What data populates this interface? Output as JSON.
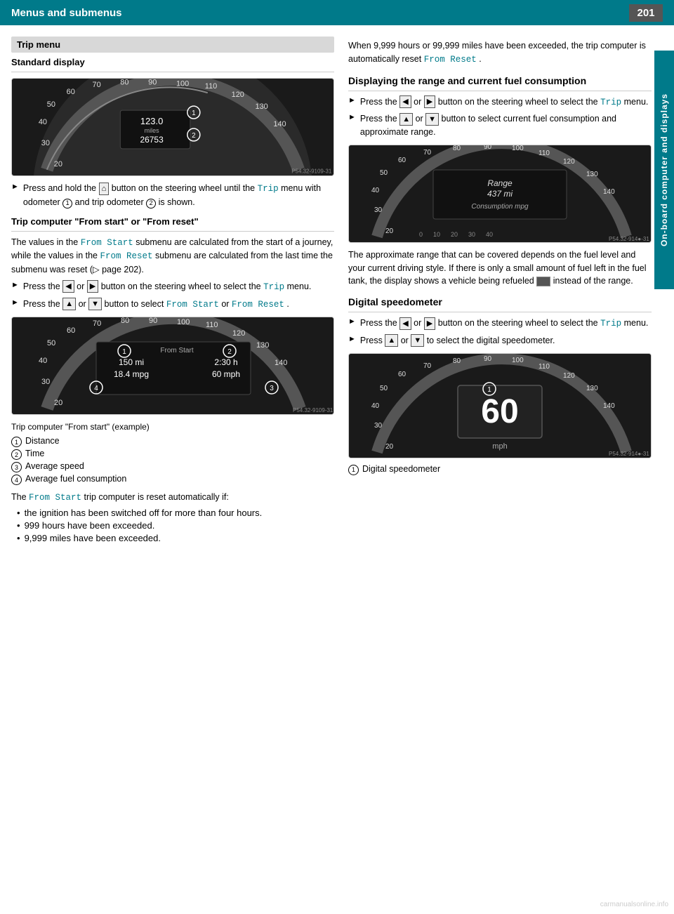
{
  "header": {
    "title": "Menus and submenus",
    "page": "201"
  },
  "sidebar": {
    "label": "On-board computer and displays"
  },
  "left": {
    "trip_menu_label": "Trip menu",
    "standard_display_title": "Standard display",
    "press_hold_instruction": "Press and hold the",
    "press_hold_instruction2": "button on the steering wheel until the",
    "trip_code": "Trip",
    "press_hold_instruction3": "menu with odometer",
    "odometer_num": "1",
    "press_hold_instruction4": "and trip odometer",
    "trip_odo_num": "2",
    "press_hold_instruction5": "is shown.",
    "trip_computer_title": "Trip computer \"From start\" or \"From reset\"",
    "body1": "The values in the",
    "from_start_code": "From Start",
    "body2": "submenu are calculated from the start of a journey, while the values in the",
    "from_reset_code": "From Reset",
    "body3": "submenu are calculated from the last time the submenu was reset (▷ page 202).",
    "press1": "Press the",
    "or1": "or",
    "btn_steer1": "button on the steering wheel to select the",
    "trip_code2": "Trip",
    "menu_text": "menu.",
    "press2": "Press the",
    "or2": "or",
    "btn_select": "button to select",
    "from_start_code2": "From Start",
    "or3": "or",
    "from_reset_code2": "From Reset",
    "period": ".",
    "caption1": "Trip computer \"From start\" (example)",
    "item1_num": "1",
    "item1_label": "Distance",
    "item2_num": "2",
    "item2_label": "Time",
    "item3_num": "3",
    "item3_label": "Average speed",
    "item4_num": "4",
    "item4_label": "Average fuel consumption",
    "body_from_start": "The",
    "from_start_code3": "From Start",
    "body_from_start2": "trip computer is reset automatically if:",
    "bullet1": "the ignition has been switched off for more than four hours.",
    "bullet2": "999 hours have been exceeded.",
    "bullet3": "9,999 miles have been exceeded."
  },
  "right": {
    "body_when": "When 9,999 hours or 99,999 miles have been exceeded, the trip computer is automatically reset",
    "from_reset_code": "From Reset",
    "period": ".",
    "displaying_title": "Displaying the range and current fuel consumption",
    "press_range1": "Press the",
    "or_range1": "or",
    "range_btn1": "button on the steering wheel to select the",
    "trip_code_range": "Trip",
    "range_menu": "menu.",
    "press_range2": "Press the",
    "or_range2": "or",
    "range_btn2": "button to select current fuel consumption and approximate range.",
    "range_body1": "The approximate range that can be covered depends on the fuel level and your current driving style. If there is only a small amount of fuel left in the fuel tank, the display shows a vehicle being refueled",
    "range_body2": "instead of the range.",
    "digital_speedo_title": "Digital speedometer",
    "press_dig1": "Press the",
    "or_dig1": "or",
    "dig_btn1": "button on the steering wheel to select the",
    "trip_code_dig": "Trip",
    "dig_menu": "menu.",
    "press_dig2": "Press",
    "or_dig2": "or",
    "dig_btn2": "to select the digital speedometer.",
    "caption_dig": "1",
    "caption_dig_label": "Digital speedometer"
  },
  "images": {
    "ref1": "P54.32-9109-31",
    "ref2": "P54.32-9109-31",
    "ref3": "P54.32-914●-31",
    "ref4": "P54.32-914●-31"
  }
}
